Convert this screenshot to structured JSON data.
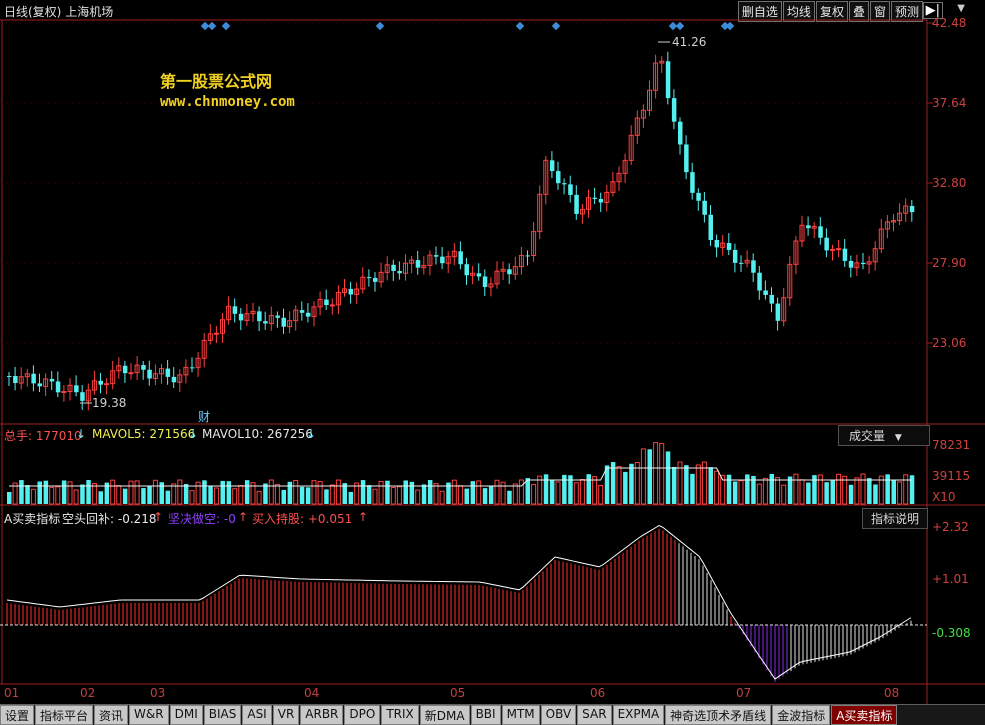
{
  "header": {
    "period": "日线(复权)",
    "stock": "上海机场",
    "buttons": [
      "删自选",
      "均线",
      "复权",
      "叠",
      "窗",
      "预测"
    ]
  },
  "watermark": {
    "line1": "第一股票公式网",
    "line2": "www.chnmoney.com"
  },
  "price_panel": {
    "y_labels": [
      "42.48",
      "37.64",
      "32.80",
      "27.90",
      "23.06"
    ],
    "high_label": "41.26",
    "low_label": "19.38",
    "finance_marker": "财"
  },
  "volume_panel": {
    "total": "总手: 177010",
    "mavol5": "MAVOL5: 271566",
    "mavol10": "MAVOL10: 267256",
    "button": "成交量",
    "y_labels": [
      "78231",
      "39115"
    ],
    "unit": "X10"
  },
  "indicator_panel": {
    "name": "A买卖指标",
    "v1": "空头回补: -0.218",
    "v2": "坚决做空: -0",
    "v3": "买入持股: +0.051",
    "button": "指标说明",
    "y_labels": [
      "+2.32",
      "+1.01",
      "-0.308"
    ]
  },
  "x_axis": [
    "01",
    "02",
    "03",
    "04",
    "05",
    "06",
    "07",
    "08"
  ],
  "tabs": [
    "设置",
    "指标平台",
    "资讯",
    "W&R",
    "DMI",
    "BIAS",
    "ASI",
    "VR",
    "ARBR",
    "DPO",
    "TRIX",
    "新DMA",
    "BBI",
    "MTM",
    "OBV",
    "SAR",
    "EXPMA",
    "神奇选顶术矛盾线",
    "金波指标",
    "A买卖指标"
  ],
  "colors": {
    "up": "#ff4040",
    "down": "#54f0f0",
    "axis": "#a02020",
    "text": "#c8c8c8"
  }
}
